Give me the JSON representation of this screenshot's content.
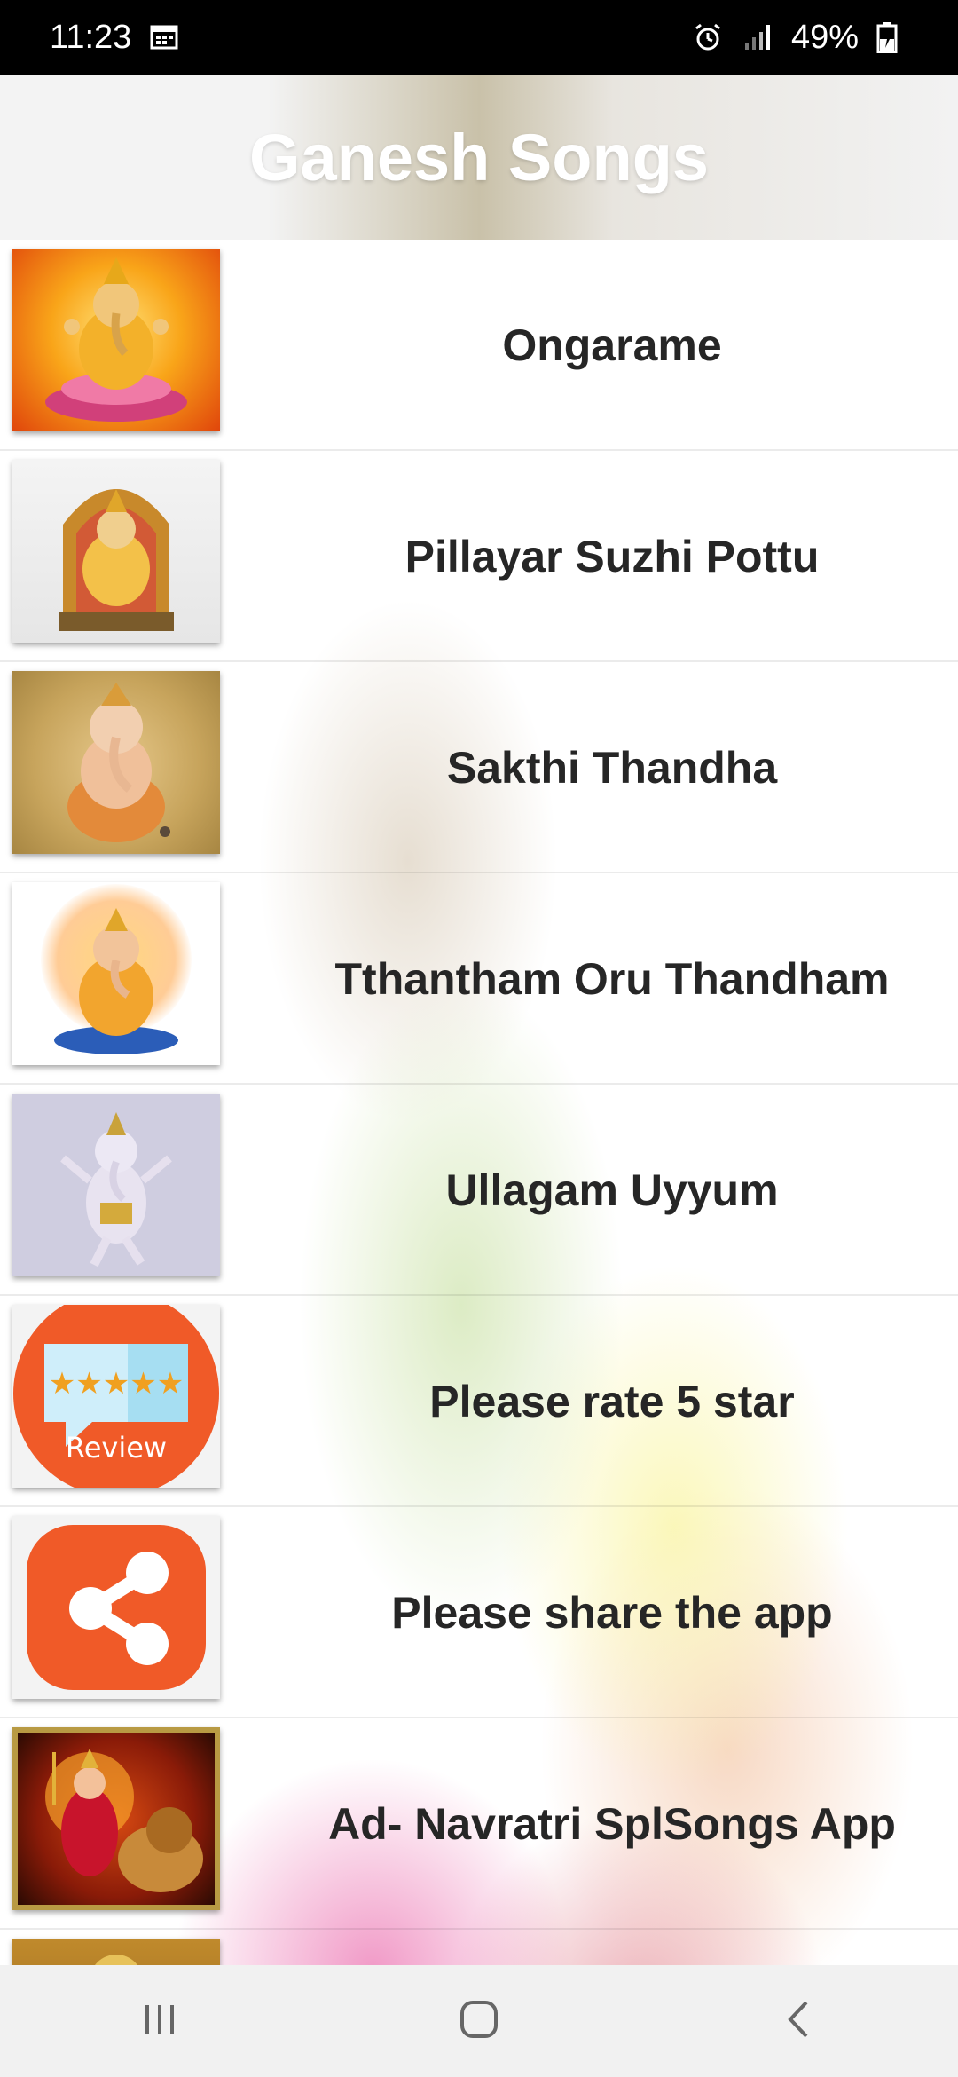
{
  "status_bar": {
    "time": "11:23",
    "battery_percent": "49%",
    "icons": [
      "calendar-icon",
      "alarm-icon",
      "signal-icon",
      "battery-charging-icon"
    ]
  },
  "header": {
    "title": "Ganesh Songs"
  },
  "list": {
    "items": [
      {
        "label": "Ongarame",
        "thumb": "ganesha-on-lotus-image"
      },
      {
        "label": "Pillayar Suzhi Pottu",
        "thumb": "ganesha-on-throne-image"
      },
      {
        "label": "Sakthi Thandha",
        "thumb": "ganesha-seated-image"
      },
      {
        "label": "Tthantham Oru Thandham",
        "thumb": "ganesha-with-halo-image"
      },
      {
        "label": "Ullagam Uyyum",
        "thumb": "ganesha-dancing-image"
      },
      {
        "label": "Please rate 5 star",
        "thumb": "review-stars-icon",
        "review_badge": "Review"
      },
      {
        "label": "Please share the app",
        "thumb": "share-icon"
      },
      {
        "label": "Ad- Navratri SplSongs App",
        "thumb": "durga-on-lion-image"
      },
      {
        "label": "",
        "thumb": "partial-next-image"
      }
    ]
  },
  "nav_bar": {
    "buttons": [
      "recent-apps-icon",
      "home-icon",
      "back-icon"
    ]
  },
  "colors": {
    "status_bar_bg": "#000000",
    "header_title": "#ffffff",
    "row_text": "#262626",
    "nav_bar_bg": "#f1f1f1",
    "share_orange": "#f05a28",
    "review_orange": "#f05a28"
  }
}
